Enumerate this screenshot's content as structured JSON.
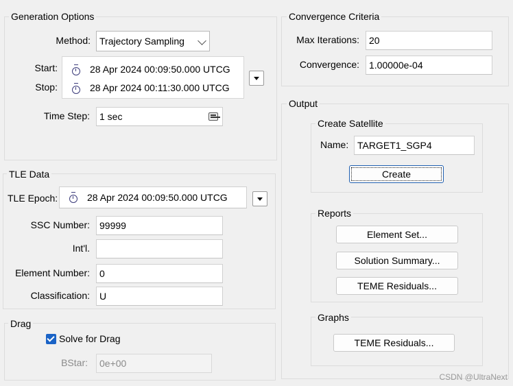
{
  "generation": {
    "title": "Generation Options",
    "method_label": "Method:",
    "method_value": "Trajectory Sampling",
    "start_label": "Start:",
    "start_value": "28 Apr 2024 00:09:50.000 UTCG",
    "stop_label": "Stop:",
    "stop_value": "28 Apr 2024 00:11:30.000 UTCG",
    "timestep_label": "Time Step:",
    "timestep_value": "1 sec"
  },
  "tle": {
    "title": "TLE Data",
    "epoch_label": "TLE Epoch:",
    "epoch_value": "28 Apr 2024 00:09:50.000 UTCG",
    "ssc_label": "SSC Number:",
    "ssc_value": "99999",
    "intl_label": "Int'l.",
    "intl_value": "",
    "element_label": "Element Number:",
    "element_value": "0",
    "class_label": "Classification:",
    "class_value": "U"
  },
  "drag": {
    "title": "Drag",
    "solve_label": "Solve for Drag",
    "solve_checked": true,
    "bstar_label": "BStar:",
    "bstar_value": "0e+00"
  },
  "convergence": {
    "title": "Convergence Criteria",
    "maxiter_label": "Max Iterations:",
    "maxiter_value": "20",
    "conv_label": "Convergence:",
    "conv_value": "1.00000e-04"
  },
  "output": {
    "title": "Output",
    "create_sat": {
      "title": "Create Satellite",
      "name_label": "Name:",
      "name_value": "TARGET1_SGP4",
      "create_button": "Create"
    },
    "reports": {
      "title": "Reports",
      "element_set": "Element Set...",
      "solution_summary": "Solution Summary...",
      "teme_residuals": "TEME Residuals..."
    },
    "graphs": {
      "title": "Graphs",
      "teme_residuals": "TEME Residuals..."
    }
  },
  "watermark": "CSDN @UltraNext"
}
